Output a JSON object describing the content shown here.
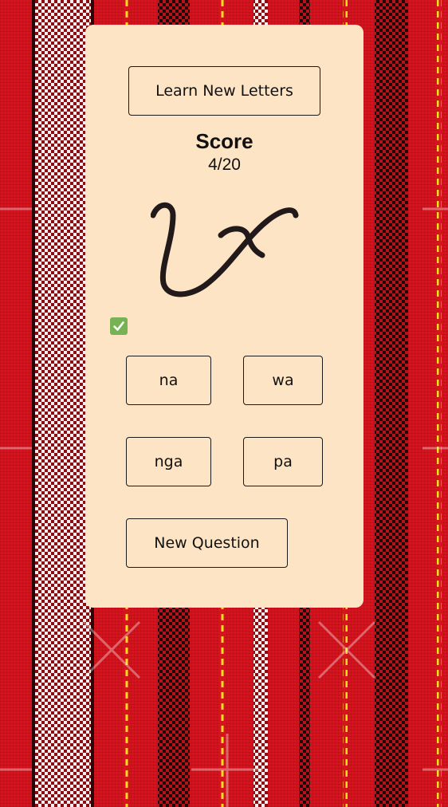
{
  "learn_button": {
    "label": "Learn New Letters"
  },
  "score": {
    "title": "Score",
    "value": "4/20"
  },
  "question": {
    "glyph_icon": "baybayin-character-icon",
    "feedback_icon": "check-mark-icon",
    "feedback_color": "#77b255"
  },
  "choices": [
    {
      "label": "na"
    },
    {
      "label": "wa"
    },
    {
      "label": "nga"
    },
    {
      "label": "pa"
    }
  ],
  "new_question_button": {
    "label": "New Question"
  },
  "colors": {
    "background": "#d6141e",
    "card": "#fde4c4",
    "border": "#1a1a1a"
  }
}
